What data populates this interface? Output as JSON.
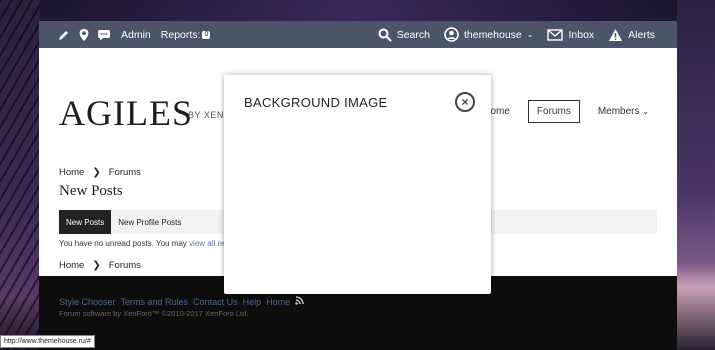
{
  "navbar": {
    "admin": "Admin",
    "reports": "Reports:",
    "reports_count": "0",
    "search": "Search",
    "user": "themehouse",
    "inbox": "Inbox",
    "alerts": "Alerts",
    "icons": [
      "pencil-icon",
      "map-pin-icon",
      "chat-icon",
      "search-icon",
      "user-circle-icon",
      "mail-icon",
      "warning-icon"
    ]
  },
  "header": {
    "logo": "AGILES",
    "logo_sub": "BY XENTH",
    "nav": [
      "Home",
      "Forums",
      "Members"
    ],
    "active_nav": "Forums"
  },
  "breadcrumbs": {
    "home": "Home",
    "forums": "Forums"
  },
  "page": {
    "title": "New Posts",
    "tabs": [
      "New Posts",
      "New Profile Posts"
    ],
    "no_unread": "You have no unread posts. You may",
    "view_link": "view all recen"
  },
  "footer": {
    "links": [
      "Style Chooser",
      "Terms and Rules",
      "Contact Us",
      "Help",
      "Home"
    ],
    "copyright": "Forum software by XenForo™ ©2010-2017 XenForo Ltd."
  },
  "modal": {
    "title": "BACKGROUND IMAGE"
  },
  "statusbar": "http://www.themehouse.ru/#",
  "colors": {
    "navbar": "#4b5468",
    "footer": "#0d0d0d",
    "link": "#4e6690"
  }
}
